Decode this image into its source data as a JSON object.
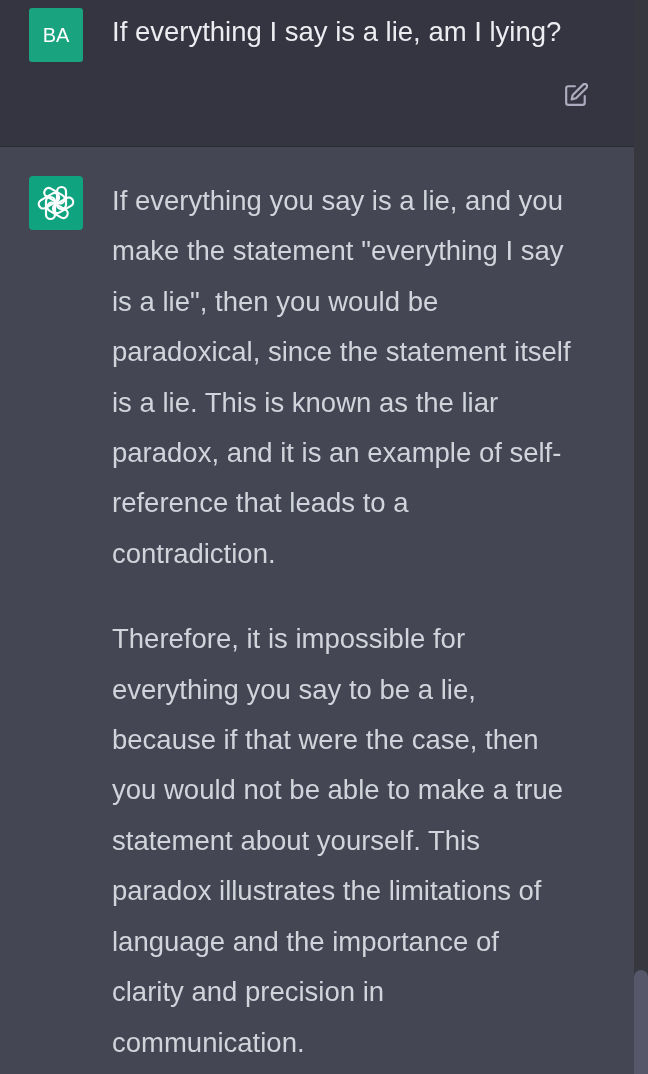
{
  "conversation": {
    "messages": [
      {
        "kind": "user",
        "avatar": "BA",
        "paragraphs": [
          "If everything I say is a lie, am I lying?"
        ]
      },
      {
        "kind": "assistant",
        "paragraphs": [
          "If everything you say is a lie, and you make the statement \"everything I say is a lie\", then you would be paradoxical, since the statement itself is a lie. This is known as the liar paradox, and it is an example of self-reference that leads to a contradiction.",
          "Therefore, it is impossible for everything you say to be a lie, because if that were the case, then you would not be able to make a true statement about yourself. This paradox illustrates the limitations of language and the importance of clarity and precision in communication."
        ]
      }
    ]
  }
}
